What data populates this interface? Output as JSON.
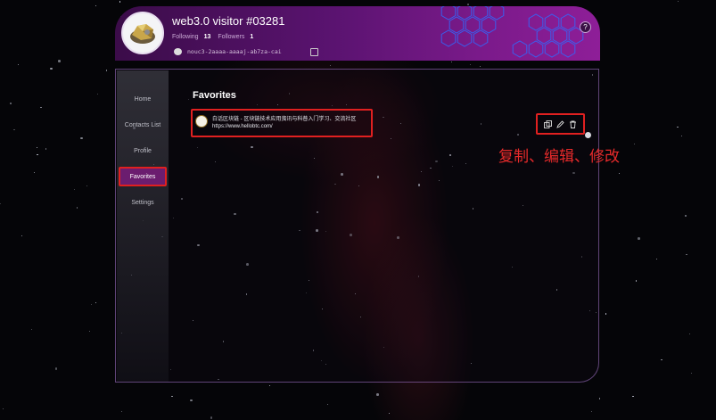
{
  "profile": {
    "username": "web3.0 visitor #03281",
    "following_label": "Following",
    "following_count": "13",
    "followers_label": "Followers",
    "followers_count": "1",
    "address": "nouc3-2aaaa-aaaaj-ab7za-cai"
  },
  "header": {
    "help_label": "?"
  },
  "sidebar": {
    "items": [
      {
        "label": "Home"
      },
      {
        "label": "Contacts List"
      },
      {
        "label": "Profile"
      },
      {
        "label": "Favorites"
      },
      {
        "label": "Settings"
      }
    ],
    "active_index": 3
  },
  "main": {
    "title": "Favorites",
    "favorites": [
      {
        "title": "白话区块链 - 区块链技术应用资讯与科普入门学习、交流社区",
        "url": "https://www.hellobtc.com/"
      }
    ]
  },
  "actions": {
    "copy_icon": "copy-icon",
    "edit_icon": "edit-icon",
    "delete_icon": "trash-icon"
  },
  "annotation": "复制、编辑、修改",
  "colors": {
    "accent": "#6b1d6f",
    "highlight": "#e02020",
    "header_start": "#3b0c49",
    "header_end": "#8e1e98"
  }
}
